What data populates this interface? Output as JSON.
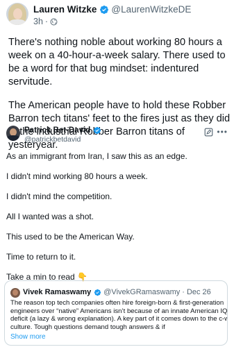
{
  "post": {
    "author_name": "Lauren Witzke",
    "author_handle": "@LaurenWitzkeDE",
    "time": "3h",
    "separator": "·",
    "audience_icon": "globe-icon",
    "paragraphs": [
      "There's nothing noble about working 80 hours a week on a 40-hour-a-week salary. There used to be a word for that bug mindset: indentured servitude.",
      "The American people have to hold these Robber Barron tech titans' feet to the fires just as they did to the industrial Robber Barron titans of yesteryear."
    ]
  },
  "quoted": {
    "author_name": "Patrick Bet-David",
    "author_handle": "@patrickbetdavid",
    "edit_icon": "edit-icon",
    "more_icon": "more-icon",
    "lines": [
      "As an immigrant from Iran, I saw this as an edge.",
      "I didn't mind working 80 hours a week.",
      "I didn't mind the competition.",
      "All I wanted was a shot.",
      "This used to be the American Way.",
      "Time to return to it.",
      "Take a min to read"
    ],
    "emoji": "👇"
  },
  "nested_quote": {
    "author_name": "Vivek Ramaswamy",
    "author_handle": "@VivekGRamaswamy",
    "separator": "·",
    "date": "Dec 26",
    "body_lines": [
      "The reason top tech companies often hire foreign-born & first-generation",
      "engineers over “native” Americans isn’t because of an innate American IQ",
      "deficit (a lazy & wrong explanation). A key part of it comes down to the c-word:",
      "culture. Tough questions demand tough answers & if"
    ],
    "show_more": "Show more"
  },
  "colors": {
    "text": "#0f1419",
    "secondary": "#536471",
    "verified": "#1d9bf0",
    "link": "#1d9bf0",
    "border": "#cfd9de"
  }
}
